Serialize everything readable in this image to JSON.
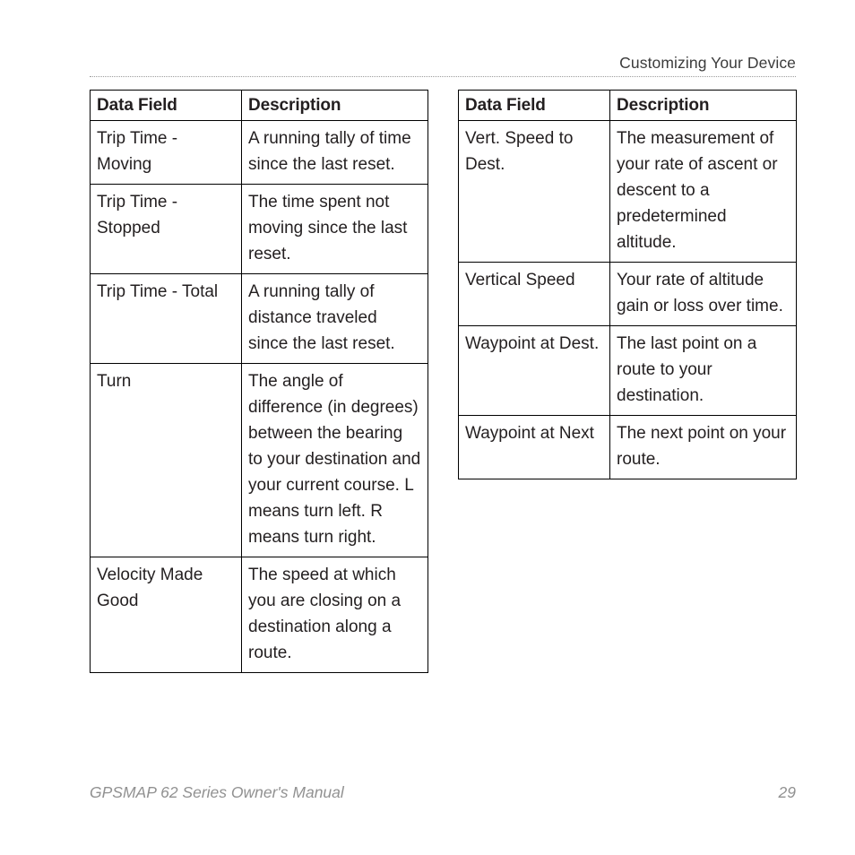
{
  "header": {
    "section_title": "Customizing Your Device"
  },
  "tables": [
    {
      "id": "left",
      "columns": [
        "Data Field",
        "Description"
      ],
      "rows": [
        [
          "Trip Time - Moving",
          "A running tally of time since the last reset."
        ],
        [
          "Trip Time - Stopped",
          "The time spent not moving since the last reset."
        ],
        [
          "Trip Time - Total",
          "A running tally of distance traveled since the last reset."
        ],
        [
          "Turn",
          "The angle of difference (in degrees) between the bearing to your destination and your current course. L means turn left. R means turn right."
        ],
        [
          "Velocity Made Good",
          "The speed at which you are closing on a destination along a route."
        ]
      ]
    },
    {
      "id": "right",
      "columns": [
        "Data Field",
        "Description"
      ],
      "rows": [
        [
          "Vert. Speed to Dest.",
          "The measurement of your rate of ascent or descent to a predetermined altitude."
        ],
        [
          "Vertical Speed",
          "Your rate of altitude gain or loss over time."
        ],
        [
          "Waypoint at Dest.",
          "The last point on a route to your destination."
        ],
        [
          "Waypoint at Next",
          "The next point on your route."
        ]
      ]
    }
  ],
  "footer": {
    "manual_title": "GPSMAP 62 Series Owner's Manual",
    "page_number": "29"
  }
}
